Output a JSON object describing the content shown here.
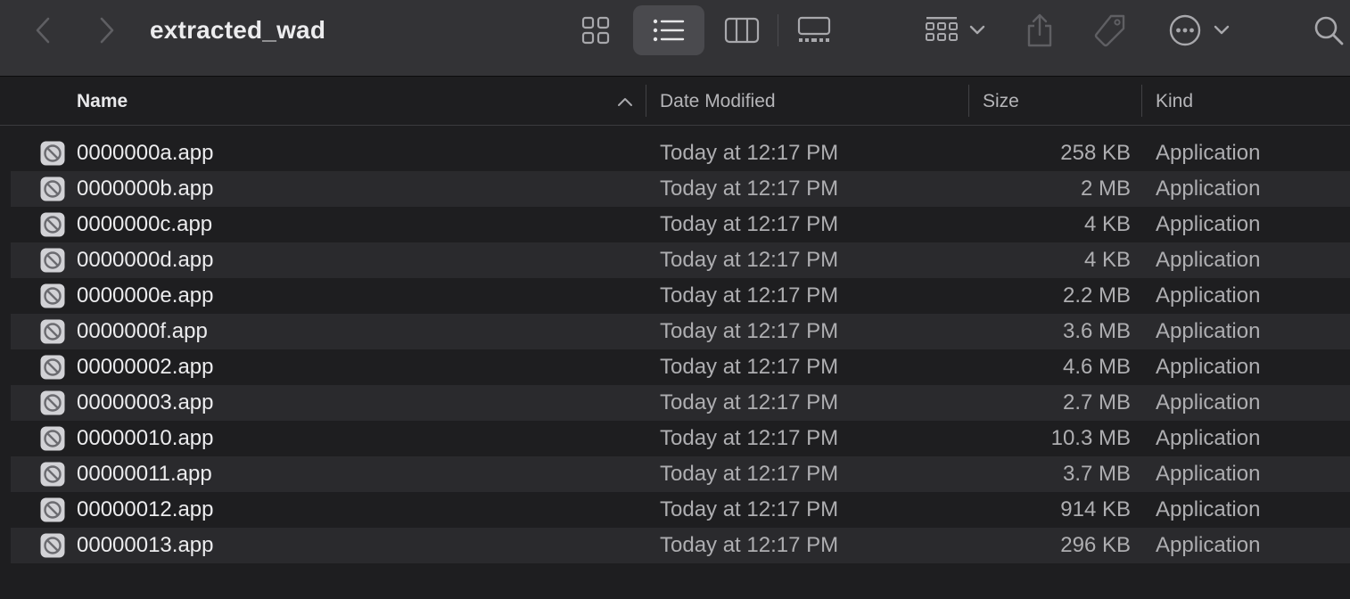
{
  "window": {
    "title": "extracted_wad"
  },
  "toolbar": {
    "icons": {
      "back": "chevron-left-icon",
      "forward": "chevron-right-icon",
      "icon_view": "grid-icon",
      "list_view": "list-icon",
      "column_view": "columns-icon",
      "gallery_view": "gallery-icon",
      "group": "group-icon",
      "share": "share-icon",
      "tag": "tag-icon",
      "more": "ellipsis-circle-icon",
      "search": "magnifier-icon"
    },
    "selected_view": "list"
  },
  "columns": {
    "name": "Name",
    "date": "Date Modified",
    "size": "Size",
    "kind": "Kind",
    "sort": "name-ascending"
  },
  "files": [
    {
      "name": "0000000a.app",
      "date": "Today at 12:17 PM",
      "size": "258 KB",
      "kind": "Application"
    },
    {
      "name": "0000000b.app",
      "date": "Today at 12:17 PM",
      "size": "2 MB",
      "kind": "Application"
    },
    {
      "name": "0000000c.app",
      "date": "Today at 12:17 PM",
      "size": "4 KB",
      "kind": "Application"
    },
    {
      "name": "0000000d.app",
      "date": "Today at 12:17 PM",
      "size": "4 KB",
      "kind": "Application"
    },
    {
      "name": "0000000e.app",
      "date": "Today at 12:17 PM",
      "size": "2.2 MB",
      "kind": "Application"
    },
    {
      "name": "0000000f.app",
      "date": "Today at 12:17 PM",
      "size": "3.6 MB",
      "kind": "Application"
    },
    {
      "name": "00000002.app",
      "date": "Today at 12:17 PM",
      "size": "4.6 MB",
      "kind": "Application"
    },
    {
      "name": "00000003.app",
      "date": "Today at 12:17 PM",
      "size": "2.7 MB",
      "kind": "Application"
    },
    {
      "name": "00000010.app",
      "date": "Today at 12:17 PM",
      "size": "10.3 MB",
      "kind": "Application"
    },
    {
      "name": "00000011.app",
      "date": "Today at 12:17 PM",
      "size": "3.7 MB",
      "kind": "Application"
    },
    {
      "name": "00000012.app",
      "date": "Today at 12:17 PM",
      "size": "914 KB",
      "kind": "Application"
    },
    {
      "name": "00000013.app",
      "date": "Today at 12:17 PM",
      "size": "296 KB",
      "kind": "Application"
    }
  ],
  "colors": {
    "toolbar_bg": "#333336",
    "window_bg": "#1e1e20",
    "row_alt_bg": "#2a2a2d",
    "selected_view_bg": "#4a4a4e"
  }
}
